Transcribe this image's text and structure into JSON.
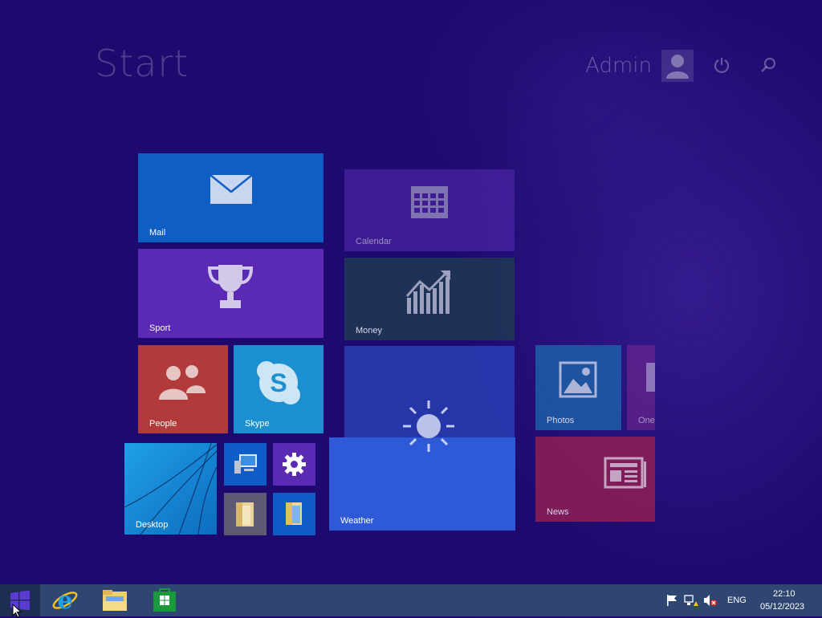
{
  "start": {
    "title": "Start"
  },
  "user": {
    "name": "Admin"
  },
  "tiles": {
    "mail": "Mail",
    "sport": "Sport",
    "people": "People",
    "skype": "Skype",
    "desktop": "Desktop",
    "calendar": "Calendar",
    "money": "Money",
    "weather": "Weather",
    "photos": "Photos",
    "onedrive": "One",
    "news": "News"
  },
  "taskbar": {
    "language": "ENG",
    "time": "22:10",
    "date": "05/12/2023"
  },
  "colors": {
    "background": "#1e0a6e",
    "taskbar": "#2f4673",
    "mail": "#0f5ec4",
    "sport": "#5a2ab5",
    "people": "#b33a3a",
    "skype": "#1b8fd0",
    "calendar": "#3f1f9e",
    "money": "#1f3a52",
    "weather": "#2e5ad8",
    "photos": "#1d62a8",
    "news": "#941f54"
  }
}
